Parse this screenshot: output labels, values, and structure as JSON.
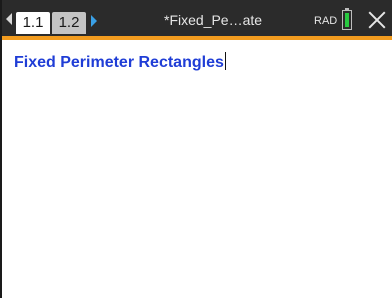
{
  "header": {
    "tabs": [
      {
        "label": "1.1",
        "active": true
      },
      {
        "label": "1.2",
        "active": false
      }
    ],
    "document_title": "*Fixed_Pe…ate",
    "angle_mode": "RAD",
    "battery_color": "#28c840",
    "accent_color": "#f29c1f"
  },
  "main": {
    "text": "Fixed Perimeter Rectangles",
    "text_color": "#1f3dd6"
  },
  "icons": {
    "previous": "chevron-left-icon",
    "next": "chevron-right-icon",
    "battery": "battery-icon",
    "close": "close-icon"
  }
}
